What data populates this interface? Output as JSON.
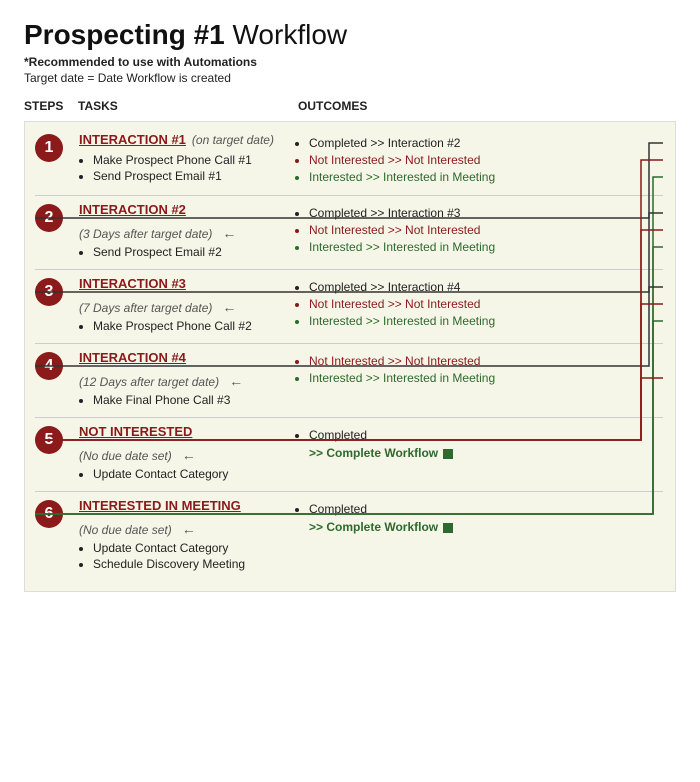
{
  "header": {
    "title_bold": "Prospecting #1",
    "title_light": " Workflow",
    "subtitle1": "*Recommended to use with Automations",
    "subtitle2": "Target date = Date Workflow is created"
  },
  "columns": {
    "steps": "STEPS",
    "tasks": "TASKS",
    "outcomes": "OUTCOMES"
  },
  "steps": [
    {
      "num": "1",
      "title": "INTERACTION #1",
      "date": "(on target date)",
      "tasks": [
        "Make Prospect Phone Call #1",
        "Send Prospect Email #1"
      ],
      "outcomes": [
        {
          "text": "Completed >> Interaction #2",
          "type": "completed"
        },
        {
          "text": "Not Interested >> Not Interested",
          "type": "not-interested"
        },
        {
          "text": "Interested >> Interested in Meeting",
          "type": "interested"
        }
      ]
    },
    {
      "num": "2",
      "title": "INTERACTION #2",
      "date": "(3 Days after target date)",
      "tasks": [
        "Send Prospect Email #2"
      ],
      "outcomes": [
        {
          "text": "Completed >> Interaction #3",
          "type": "completed"
        },
        {
          "text": "Not Interested >> Not Interested",
          "type": "not-interested"
        },
        {
          "text": "Interested >> Interested in Meeting",
          "type": "interested"
        }
      ]
    },
    {
      "num": "3",
      "title": "INTERACTION #3",
      "date": "(7 Days after target date)",
      "tasks": [
        "Make Prospect Phone Call #2"
      ],
      "outcomes": [
        {
          "text": "Completed >> Interaction #4",
          "type": "completed"
        },
        {
          "text": "Not Interested >> Not Interested",
          "type": "not-interested"
        },
        {
          "text": "Interested >> Interested in Meeting",
          "type": "interested"
        }
      ]
    },
    {
      "num": "4",
      "title": "INTERACTION #4",
      "date": "(12 Days after target date)",
      "tasks": [
        "Make Final Phone Call #3"
      ],
      "outcomes": [
        {
          "text": "Not Interested >> Not Interested",
          "type": "not-interested"
        },
        {
          "text": "Interested >> Interested in Meeting",
          "type": "interested"
        }
      ]
    },
    {
      "num": "5",
      "title": "NOT INTERESTED",
      "date": "(No due date set)",
      "tasks": [
        "Update Contact Category"
      ],
      "outcomes": [
        {
          "text": "Completed",
          "type": "completed"
        },
        {
          "text": ">> Complete Workflow",
          "type": "complete-workflow"
        }
      ]
    },
    {
      "num": "6",
      "title": "INTERESTED IN MEETING",
      "date": "(No due date set)",
      "tasks": [
        "Update Contact Category",
        "Schedule Discovery Meeting"
      ],
      "outcomes": [
        {
          "text": "Completed",
          "type": "completed"
        },
        {
          "text": ">> Complete Workflow",
          "type": "complete-workflow"
        }
      ]
    }
  ]
}
